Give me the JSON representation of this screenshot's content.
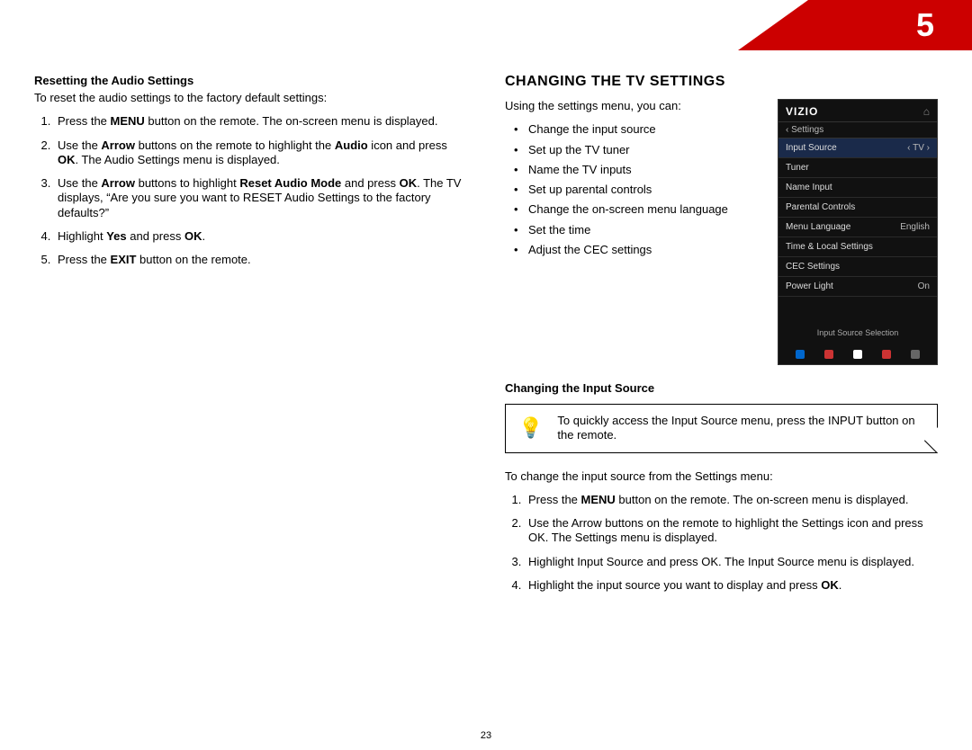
{
  "chapter": "5",
  "page_number": "23",
  "left": {
    "subhead": "Resetting the Audio Settings",
    "intro": "To reset the audio settings to the factory default settings:",
    "steps": {
      "s1a": "Press the ",
      "s1b": "MENU",
      "s1c": " button on the remote. The on-screen menu is displayed.",
      "s2a": "Use the ",
      "s2b": "Arrow",
      "s2c": " buttons on the remote to highlight the ",
      "s2d": "Audio",
      "s2e": " icon and press ",
      "s2f": "OK",
      "s2g": ". The Audio Settings menu is displayed.",
      "s3a": "Use the ",
      "s3b": "Arrow",
      "s3c": " buttons to highlight ",
      "s3d": "Reset Audio Mode",
      "s3e": " and press ",
      "s3f": "OK",
      "s3g": ". The TV displays, “Are you sure you want to RESET Audio Settings to the factory defaults?”",
      "s4a": "Highlight ",
      "s4b": "Yes",
      "s4c": " and press ",
      "s4d": "OK",
      "s4e": ".",
      "s5a": "Press the ",
      "s5b": "EXIT",
      "s5c": " button on the remote."
    }
  },
  "right": {
    "head": "CHANGING THE TV SETTINGS",
    "intro": "Using the settings menu, you can:",
    "bullets": [
      "Change the input source",
      "Set up the TV tuner",
      "Name the TV inputs",
      "Set up parental controls",
      "Change the on-screen menu language",
      "Set the time",
      "Adjust the CEC settings"
    ],
    "tv": {
      "logo": "VIZIO",
      "back": "‹  Settings",
      "rows": [
        {
          "label": "Input Source",
          "value": "‹ TV ›",
          "hl": true
        },
        {
          "label": "Tuner",
          "value": ""
        },
        {
          "label": "Name Input",
          "value": ""
        },
        {
          "label": "Parental Controls",
          "value": ""
        },
        {
          "label": "Menu Language",
          "value": "English"
        },
        {
          "label": "Time & Local Settings",
          "value": ""
        },
        {
          "label": "CEC Settings",
          "value": ""
        },
        {
          "label": "Power Light",
          "value": "On"
        }
      ],
      "caption": "Input Source Selection"
    },
    "subhead2": "Changing the Input Source",
    "tip": "To quickly access the Input Source menu, press the INPUT button on the remote.",
    "intro2": "To change the input source from the Settings menu:",
    "steps2": {
      "s1a": "Press the ",
      "s1b": "MENU",
      "s1c": " button on the remote. The on-screen menu is displayed.",
      "s2": "Use the Arrow buttons on the remote to highlight the Settings icon and press OK. The Settings menu is displayed.",
      "s3": "Highlight Input Source and press OK. The Input Source menu is displayed.",
      "s4a": "Highlight the input source you want to display and press ",
      "s4b": "OK",
      "s4c": "."
    }
  }
}
